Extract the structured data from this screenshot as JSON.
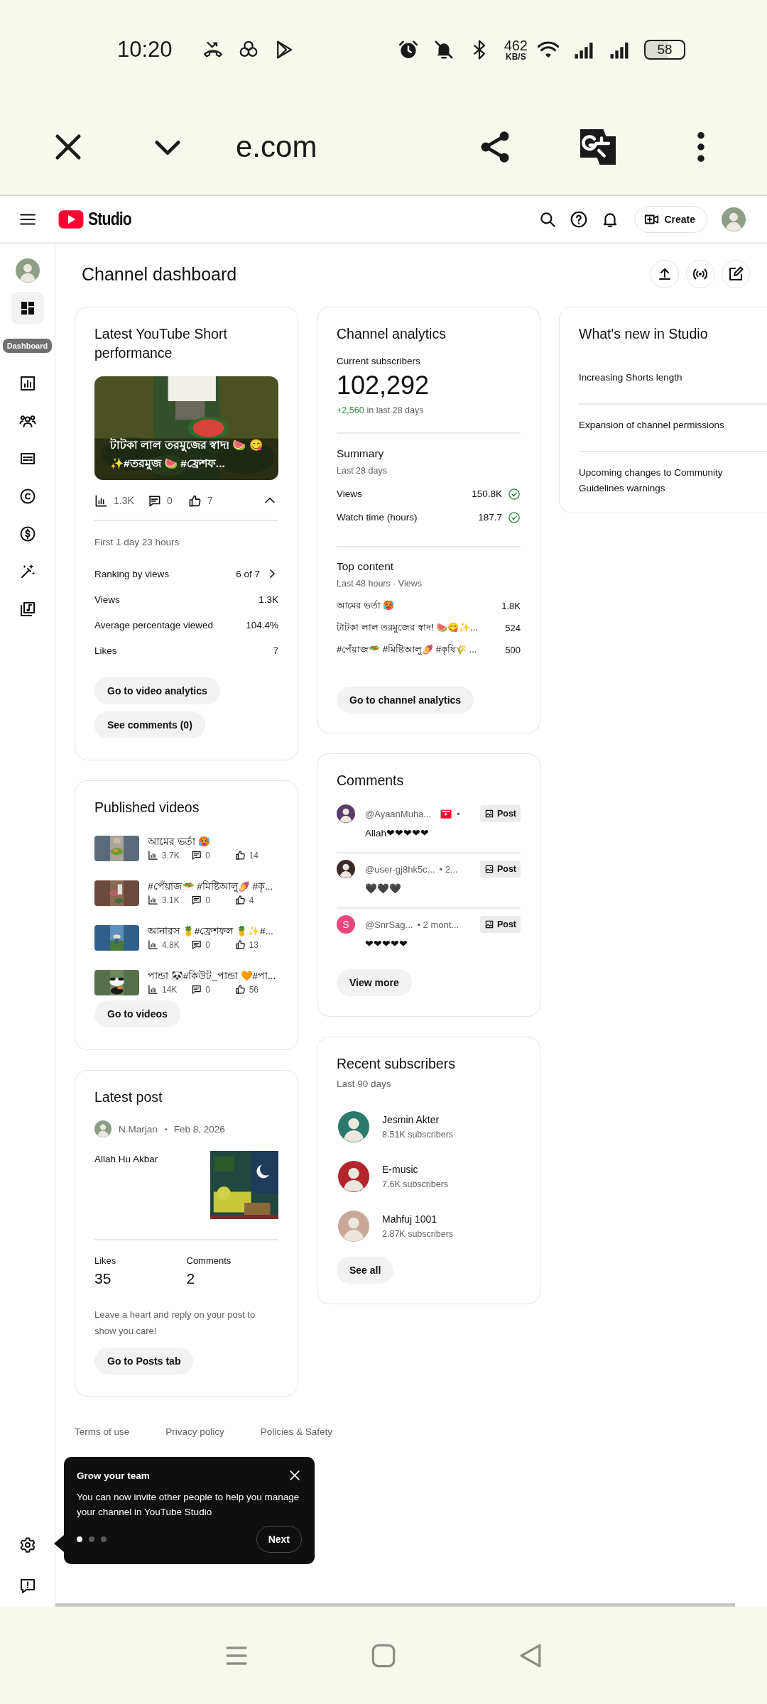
{
  "status_bar": {
    "time": "10:20",
    "net_speed": "462",
    "net_unit": "KB/S",
    "battery": "58"
  },
  "browser": {
    "url": "e.com"
  },
  "header": {
    "logo": "Studio",
    "create_button": "Create"
  },
  "sidebar": {
    "items": [
      {
        "kind": "dashboard",
        "selected": true,
        "tooltip": "Dashboard"
      },
      {
        "kind": "analytics",
        "selected": false
      },
      {
        "kind": "community",
        "selected": false
      },
      {
        "kind": "subtitles",
        "selected": false
      },
      {
        "kind": "copyright",
        "selected": false
      },
      {
        "kind": "earn",
        "selected": false
      },
      {
        "kind": "customization",
        "selected": false
      },
      {
        "kind": "audio_library",
        "selected": false
      }
    ],
    "bottom_items": [
      {
        "kind": "settings"
      },
      {
        "kind": "feedback"
      }
    ]
  },
  "page_title": "Channel dashboard",
  "short_card": {
    "title": "Latest YouTube Short performance",
    "thumbnail_caption": "টাটকা লাল তরমুজের স্বাদ! 🍉 😋✨#তরমুজ 🍉 #ফ্রেশফ...",
    "views": "1.3K",
    "comments": "0",
    "likes": "7",
    "expanded": true,
    "period": "First 1 day 23 hours",
    "metrics": [
      {
        "label": "Ranking by views",
        "value": "6 of 7",
        "link": true
      },
      {
        "label": "Views",
        "value": "1.3K",
        "link": false
      },
      {
        "label": "Average percentage viewed",
        "value": "104.4%",
        "link": false
      },
      {
        "label": "Likes",
        "value": "7",
        "link": false
      }
    ],
    "buttons": [
      "Go to video analytics",
      "See comments (0)"
    ]
  },
  "published_videos": {
    "title": "Published videos",
    "videos": [
      {
        "title": "আমের ভর্তা 🥵",
        "views": "3.7K",
        "comments": "0",
        "likes": "14"
      },
      {
        "title": "#পেঁয়াজ🥗 #মিষ্টিআলু🍠 #কৃ...",
        "views": "3.1K",
        "comments": "0",
        "likes": "4"
      },
      {
        "title": "আনারস 🍍#ফ্রেশফল 🍍✨#...",
        "views": "4.8K",
        "comments": "0",
        "likes": "13"
      },
      {
        "title": "পান্ডা 🐼#কিউট_পান্ডা 🧡#পা...",
        "views": "14K",
        "comments": "0",
        "likes": "56"
      }
    ],
    "button": "Go to videos"
  },
  "latest_post": {
    "title": "Latest post",
    "author": "N.Marjan",
    "date": "Feb 8, 2026",
    "text": "Allah Hu Akbar",
    "likes_label": "Likes",
    "likes": "35",
    "comments_label": "Comments",
    "comments": "2",
    "hint": "Leave a heart and reply on your post to show you care!",
    "button": "Go to Posts tab"
  },
  "channel_analytics": {
    "title": "Channel analytics",
    "subscribers_label": "Current subscribers",
    "subscribers": "102,292",
    "delta": "+2,560",
    "delta_note": "in last 28 days",
    "summary_title": "Summary",
    "summary_period": "Last 28 days",
    "summary": [
      {
        "label": "Views",
        "value": "150.8K"
      },
      {
        "label": "Watch time (hours)",
        "value": "187.7"
      }
    ],
    "top_title": "Top content",
    "top_period": "Last 48 hours · Views",
    "top_content": [
      {
        "title": "আমের ভর্তা 🥵",
        "value": "1.8K"
      },
      {
        "title": "টাটকা লাল তরমুজের স্বাদ! 🍉😋✨...",
        "value": "524"
      },
      {
        "title": "#পেঁয়াজ🥗 #মিষ্টিআলু🍠 #কৃষি🌾 ...",
        "value": "500"
      }
    ],
    "button": "Go to channel analytics"
  },
  "comments": {
    "title": "Comments",
    "items": [
      {
        "author": "@AyaanMuha...",
        "badge": true,
        "meta": "•",
        "chip": "Post",
        "text": "Allah❤❤❤❤❤"
      },
      {
        "author": "@user-gj8hk5c...",
        "badge": false,
        "meta": "• 2...",
        "chip": "Post",
        "text": "🖤🖤🖤"
      },
      {
        "author": "@SnrSag...",
        "badge": false,
        "meta": "• 2 mont...",
        "chip": "Post",
        "text": "❤❤❤❤❤",
        "avatar_letter": "S",
        "color": "#e8467c"
      }
    ],
    "button": "View more"
  },
  "recent_subscribers": {
    "title": "Recent subscribers",
    "period": "Last 90 days",
    "items": [
      {
        "name": "Jesmin Akter",
        "subscribers": "8.51K subscribers"
      },
      {
        "name": "E-music",
        "subscribers": "7.6K subscribers"
      },
      {
        "name": "Mahfuj 1001",
        "subscribers": "2.87K subscribers"
      }
    ],
    "button": "See all"
  },
  "whats_new": {
    "title": "What's new in Studio",
    "items": [
      "Increasing Shorts length",
      "Expansion of channel permissions",
      "Upcoming changes to Community Guidelines warnings"
    ]
  },
  "footer_links": [
    "Terms of use",
    "Privacy policy",
    "Policies & Safety"
  ],
  "tour_popup": {
    "title": "Grow your team",
    "text": "You can now invite other people to help you manage your channel in YouTube Studio",
    "steps": [
      {
        "selected": true
      },
      {
        "selected": false
      },
      {
        "selected": false
      }
    ],
    "button": "Next"
  }
}
